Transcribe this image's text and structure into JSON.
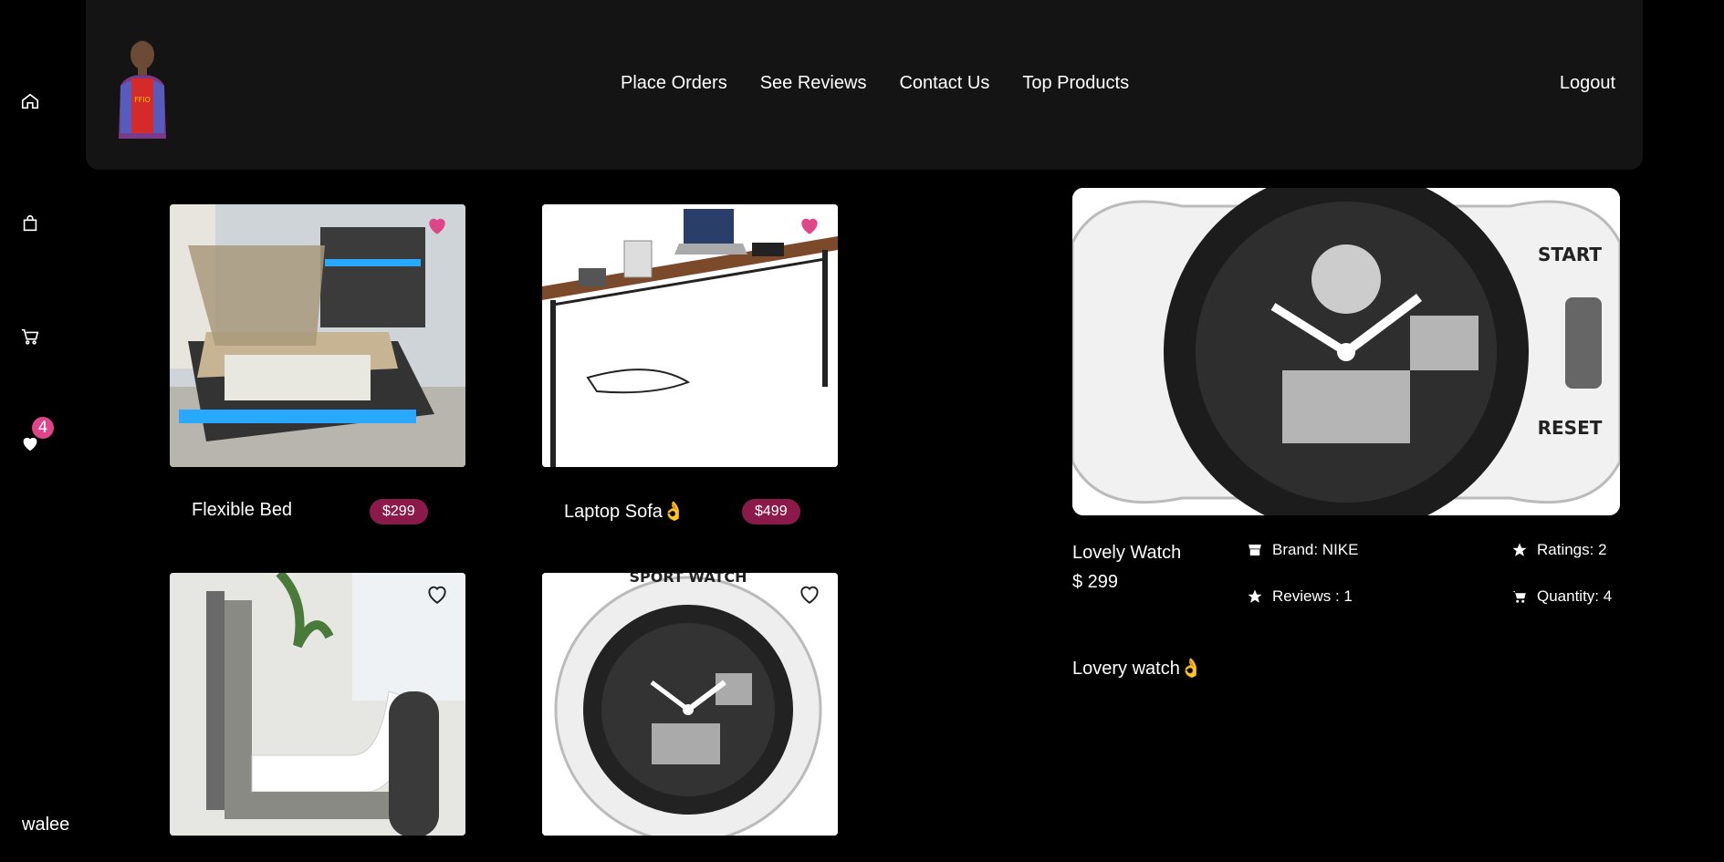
{
  "sidebar": {
    "icons": [
      "home-icon",
      "bag-icon",
      "cart-icon",
      "heart-icon"
    ],
    "wishlist_count": "4",
    "user_name": "walee"
  },
  "nav": {
    "links": [
      "Place Orders",
      "See Reviews",
      "Contact Us",
      "Top Products"
    ],
    "logout": "Logout"
  },
  "products": [
    {
      "name": "Flexible Bed",
      "price": "$299",
      "favorited": true
    },
    {
      "name": "Laptop Sofa👌",
      "price": "$499",
      "favorited": true
    },
    {
      "name": "",
      "price": "",
      "favorited": false
    },
    {
      "name": "",
      "price": "",
      "favorited": false
    }
  ],
  "detail": {
    "title": "Lovely Watch",
    "price": "$ 299",
    "brand": "Brand: NIKE",
    "ratings": "Ratings: 2",
    "reviews": "Reviews : 1",
    "quantity": "Quantity: 4",
    "description": "Lovery watch👌"
  },
  "colors": {
    "accent_pink": "#e0458a",
    "price_badge": "#8b1a4a",
    "navbar_bg": "#141414"
  }
}
